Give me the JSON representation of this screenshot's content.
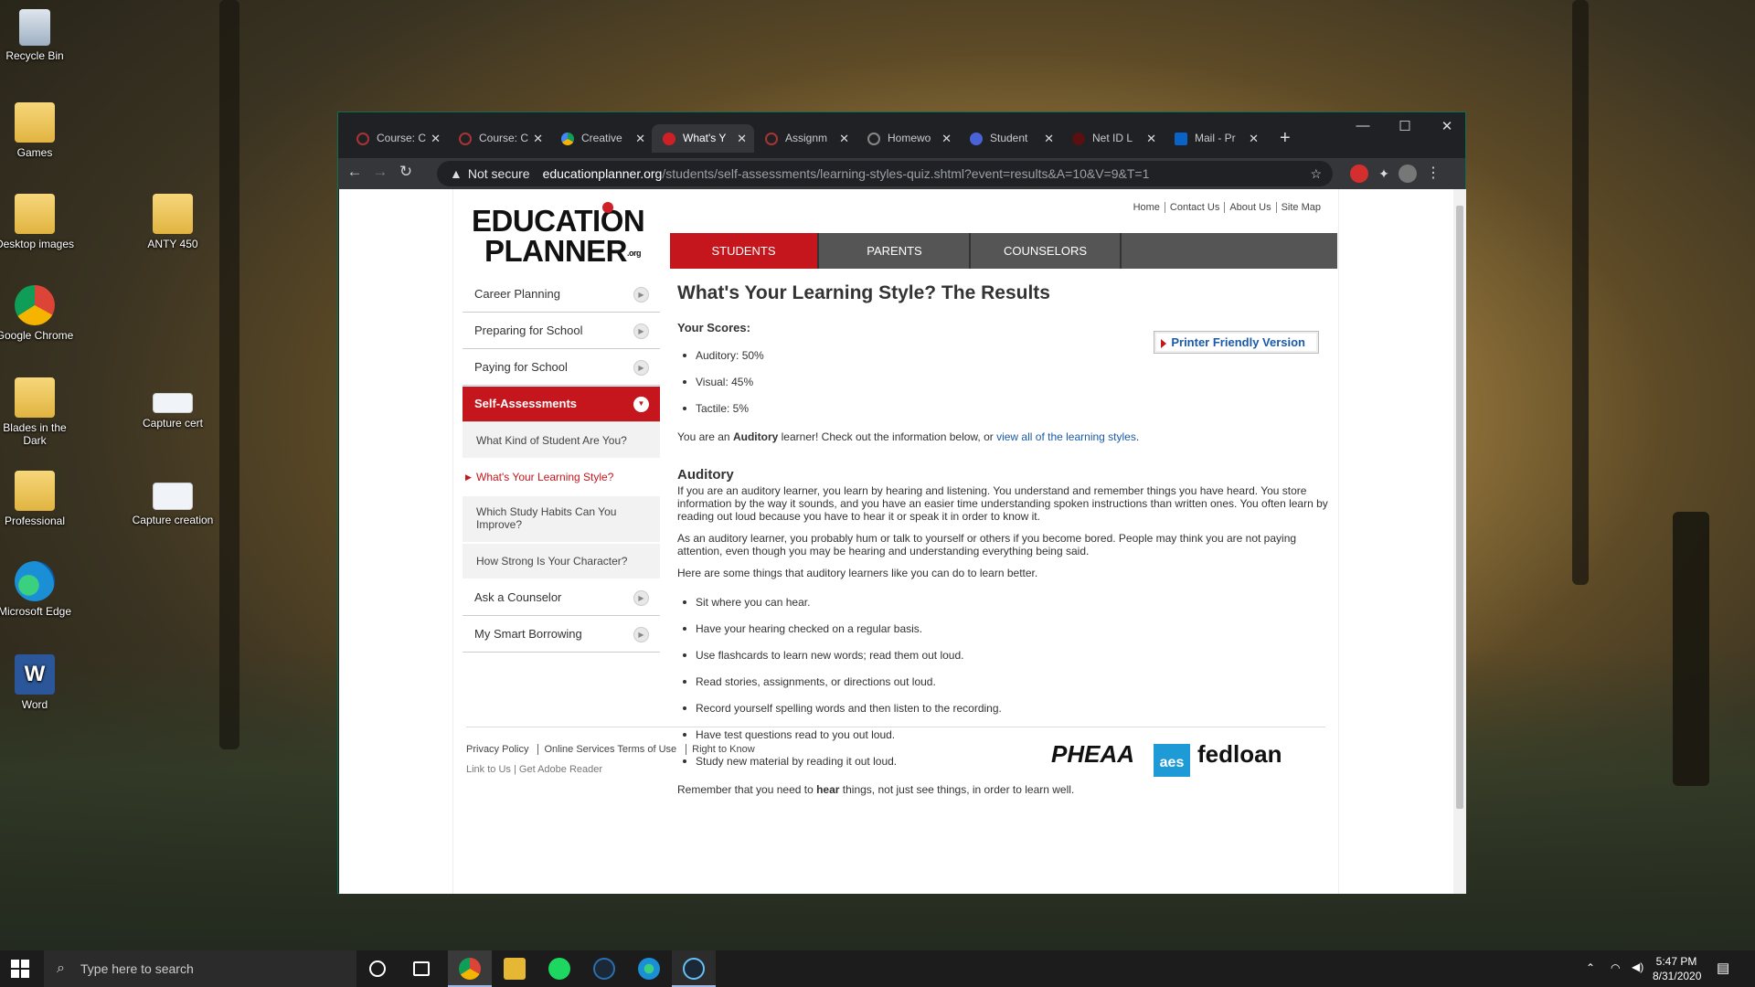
{
  "desktop": {
    "icons": [
      {
        "label": "Recycle Bin",
        "icon": "recycle-bin-icon"
      },
      {
        "label": "Games",
        "icon": "folder-icon"
      },
      {
        "label": "Desktop images",
        "icon": "folder-icon"
      },
      {
        "label": "Google Chrome",
        "icon": "chrome-icon"
      },
      {
        "label": "Blades in the Dark",
        "icon": "folder-icon"
      },
      {
        "label": "Professional",
        "icon": "folder-icon"
      },
      {
        "label": "Microsoft Edge",
        "icon": "edge-icon"
      },
      {
        "label": "Word",
        "icon": "word-icon"
      },
      {
        "label": "ANTY 450",
        "icon": "folder-icon"
      },
      {
        "label": "Capture cert",
        "icon": "image-file-icon"
      },
      {
        "label": "Capture creation",
        "icon": "image-file-icon"
      }
    ]
  },
  "browser": {
    "tabs": [
      {
        "label": "Course: C",
        "icon": "site-icon"
      },
      {
        "label": "Course: C",
        "icon": "site-icon"
      },
      {
        "label": "Creative",
        "icon": "drive-icon"
      },
      {
        "label": "What's Y",
        "icon": "educationplanner-icon",
        "active": true
      },
      {
        "label": "Assignm",
        "icon": "site-icon"
      },
      {
        "label": "Homewo",
        "icon": "globe-icon"
      },
      {
        "label": "Student",
        "icon": "student-icon"
      },
      {
        "label": "Net ID L",
        "icon": "site-icon"
      },
      {
        "label": "Mail - Pr",
        "icon": "outlook-icon"
      }
    ],
    "new_tab": "+",
    "address": {
      "security": "Not secure",
      "host": "educationplanner.org",
      "path": "/students/self-assessments/learning-styles-quiz.shtml?event=results&A=10&V=9&T=1"
    }
  },
  "site": {
    "logo": {
      "line1": "EDUCATION",
      "line2": "PLANNER",
      "suffix": ".org"
    },
    "top_links": [
      "Home",
      "Contact Us",
      "About Us",
      "Site Map"
    ],
    "main_nav": [
      "STUDENTS",
      "PARENTS",
      "COUNSELORS"
    ],
    "sidebar": {
      "items": [
        "Career Planning",
        "Preparing for School",
        "Paying for School",
        "Self-Assessments",
        "Ask a Counselor",
        "My Smart Borrowing"
      ],
      "sub_items": [
        "What Kind of Student Are You?",
        "What's Your Learning Style?",
        "Which Study Habits Can You Improve?",
        "How Strong Is Your Character?"
      ]
    },
    "content": {
      "title": "What's Your Learning Style? The Results",
      "print_label": "Printer Friendly Version",
      "scores_label": "Your Scores:",
      "scores": [
        "Auditory: 50%",
        "Visual: 45%",
        "Tactile: 5%"
      ],
      "result_pre": "You are an ",
      "result_style": "Auditory",
      "result_mid": " learner! Check out the information below, or ",
      "result_link": "view all of the learning styles",
      "result_end": ".",
      "section_title": "Auditory",
      "para1": "If you are an auditory learner, you learn by hearing and listening. You understand and remember things you have heard. You store information by the way it sounds, and you have an easier time understanding spoken instructions than written ones. You often learn by reading out loud because you have to hear it or speak it in order to know it.",
      "para2": "As an auditory learner, you probably hum or talk to yourself or others if you become bored. People may think you are not paying attention, even though you may be hearing and understanding everything being said.",
      "para3": "Here are some things that auditory learners like you can do to learn better.",
      "tips": [
        "Sit where you can hear.",
        "Have your hearing checked on a regular basis.",
        "Use flashcards to learn new words; read them out loud.",
        "Read stories, assignments, or directions out loud.",
        "Record yourself spelling words and then listen to the recording.",
        "Have test questions read to you out loud.",
        "Study new material by reading it out loud."
      ],
      "closing_pre": "Remember that you need to ",
      "closing_bold": "hear",
      "closing_end": " things, not just see things, in order to learn well."
    },
    "footer": {
      "links": [
        "Privacy Policy",
        "Online Services Terms of Use",
        "Right to Know"
      ],
      "links2": [
        "Link to Us",
        "Get Adobe Reader"
      ],
      "brands": [
        "PHEAA",
        "aes",
        "fedloan"
      ]
    }
  },
  "taskbar": {
    "search_placeholder": "Type here to search",
    "time": "5:47 PM",
    "date": "8/31/2020"
  }
}
